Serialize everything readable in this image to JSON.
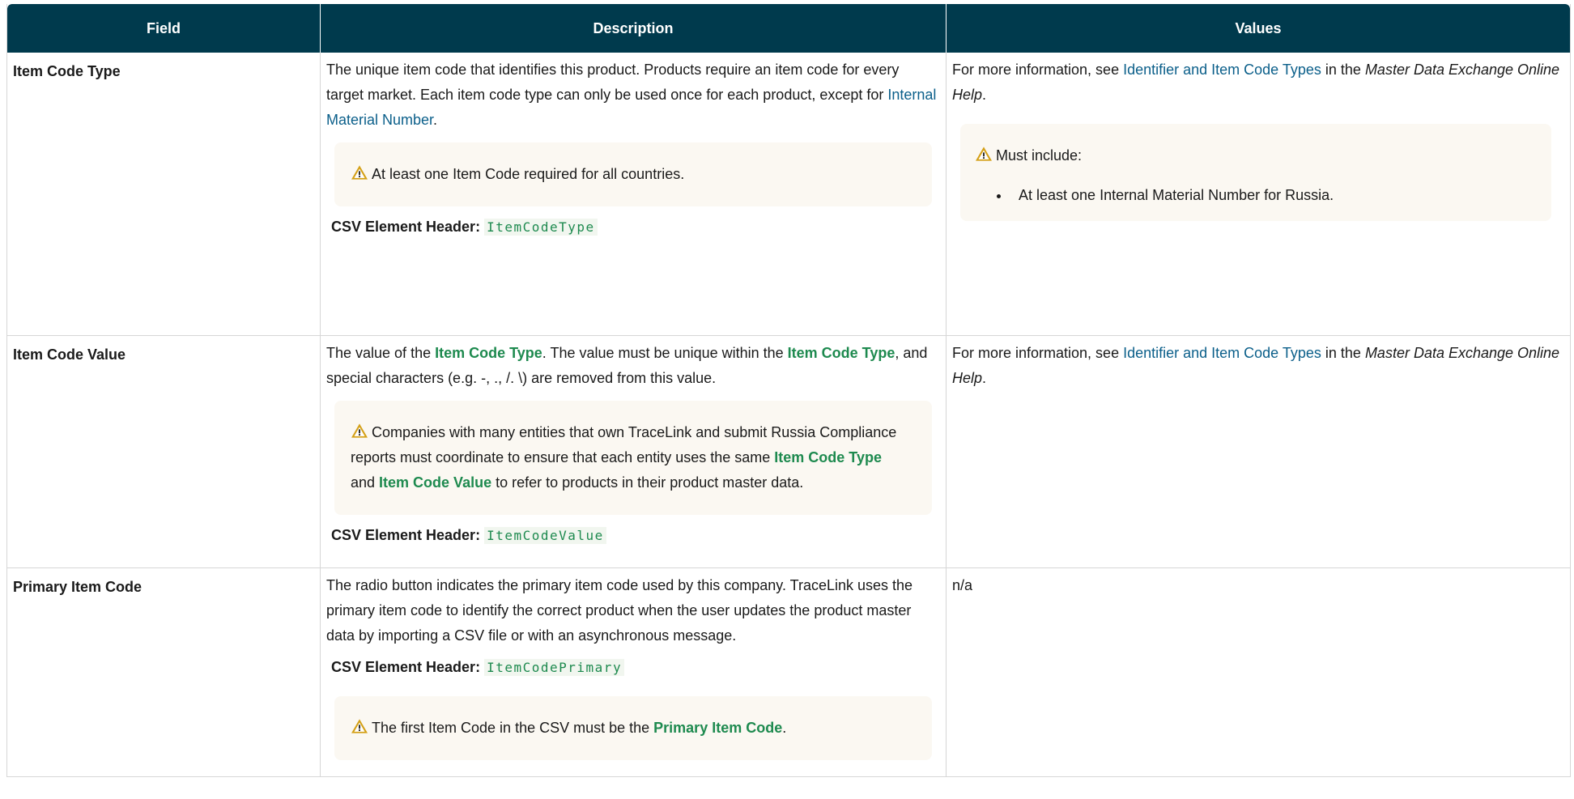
{
  "headers": {
    "field": "Field",
    "description": "Description",
    "values": "Values"
  },
  "common": {
    "csv_label": "CSV Element Header:",
    "more_info_pre": "For more information, see ",
    "more_info_link": "Identifier and Item Code Types",
    "more_info_mid": " in the ",
    "more_info_book": "Master Data Exchange Online Help",
    "more_info_end": "."
  },
  "rows": [
    {
      "field": "Item Code Type",
      "desc_a": "The unique item code that identifies this product. Products require an item code for every target market. Each item code type can only be used once for each product, except for ",
      "desc_link": "Internal Material Number",
      "desc_b": ".",
      "note": "At least one Item Code required for all countries.",
      "csv_value": "ItemCodeType",
      "values_note_title": "Must include:",
      "values_note_items": [
        "At least one Internal Material Number for Russia."
      ]
    },
    {
      "field": "Item Code Value",
      "desc_a": "The value of the ",
      "desc_link": "Item Code Type",
      "desc_b": ". The value must be unique within the ",
      "desc_link2": "Item Code Type",
      "desc_c": ", and special characters (e.g. -, ., /. \\) are removed from this value.",
      "note_a": "Companies with many entities that own TraceLink and submit Russia Compliance reports must coordinate to ensure that each entity uses the same ",
      "note_link1": "Item Code Type",
      "note_b": " and ",
      "note_link2": "Item Code Value",
      "note_c": " to refer to products in their product master data.",
      "csv_value": "ItemCodeValue"
    },
    {
      "field": "Primary Item Code",
      "desc": " The radio button indicates the primary item code used by this company. TraceLink uses the primary item code to identify the correct product when the user updates the product master data by importing a CSV file or with an asynchronous message.",
      "csv_value": "ItemCodePrimary",
      "note_a": "The first Item Code in the CSV must be the ",
      "note_link": "Primary Item Code",
      "note_b": ".",
      "values": "n/a"
    }
  ],
  "colors": {
    "header_bg": "#003a4d",
    "link": "#0b5f8a",
    "green_link": "#1e8a4f",
    "note_bg": "#fbf8f2",
    "warning": "#d4a017"
  },
  "icons": {
    "warning": "warning-icon"
  }
}
